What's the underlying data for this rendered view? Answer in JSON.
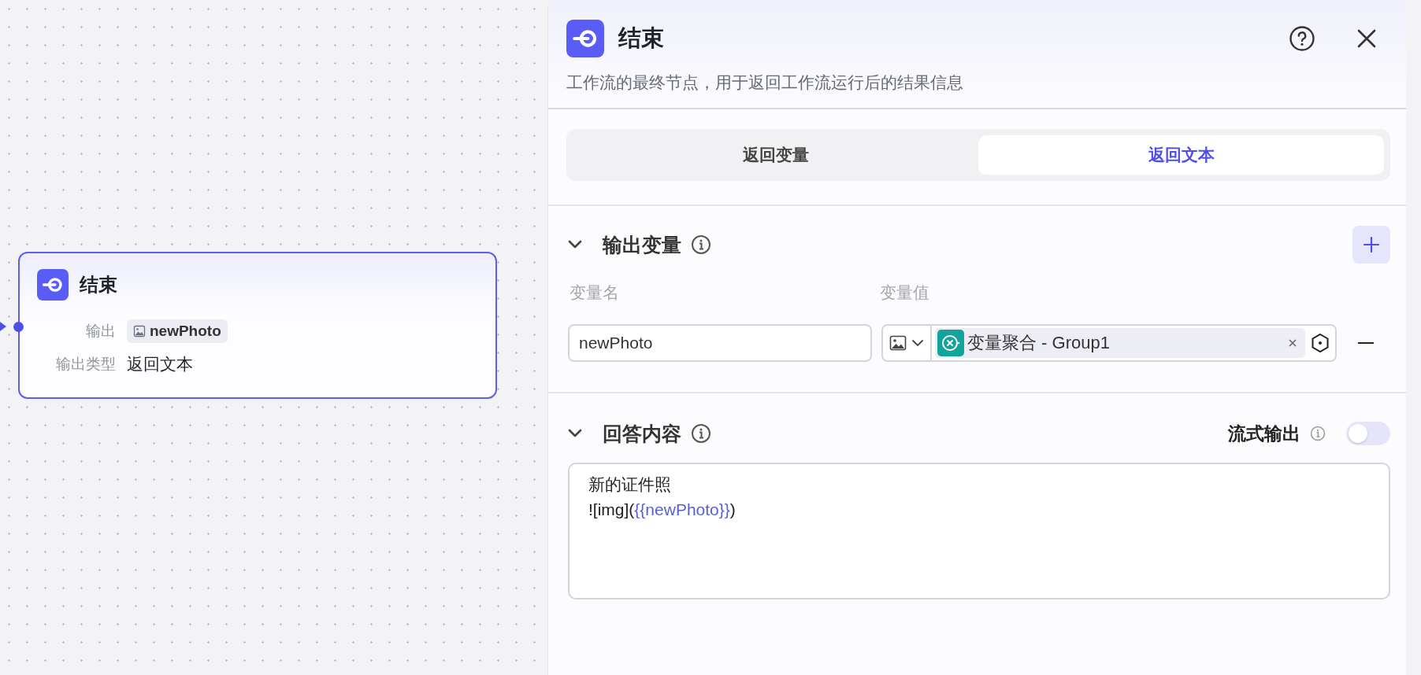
{
  "canvas_node": {
    "title": "结束",
    "fields": [
      {
        "label": "输出",
        "kind": "variable",
        "value": "newPhoto"
      },
      {
        "label": "输出类型",
        "kind": "text",
        "value": "返回文本"
      }
    ]
  },
  "panel": {
    "title": "结束",
    "description": "工作流的最终节点，用于返回工作流运行后的结果信息",
    "tabs": [
      {
        "label": "返回变量",
        "selected": false
      },
      {
        "label": "返回文本",
        "selected": true
      }
    ],
    "output_section": {
      "title": "输出变量",
      "expanded": true,
      "columns": [
        "变量名",
        "变量值"
      ],
      "rows": [
        {
          "name": "newPhoto",
          "value": "变量聚合 - Group1"
        }
      ]
    },
    "answer_section": {
      "title": "回答内容",
      "expanded": true,
      "stream_label": "流式输出",
      "stream_on": false,
      "lines": [
        {
          "parts": [
            {
              "text": "新的证件照",
              "kind": "plain"
            }
          ]
        },
        {
          "parts": [
            {
              "text": "![img](",
              "kind": "plain"
            },
            {
              "text": "{{newPhoto}}",
              "kind": "variable"
            },
            {
              "text": ")",
              "kind": "plain"
            }
          ]
        }
      ]
    }
  }
}
